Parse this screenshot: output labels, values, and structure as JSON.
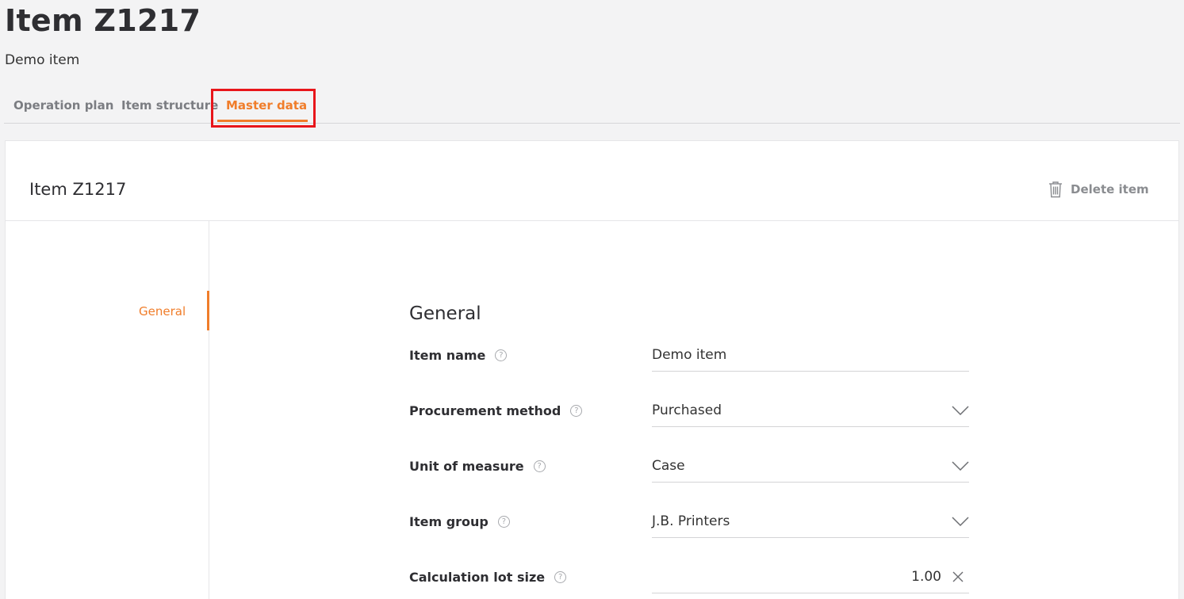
{
  "page": {
    "title": "Item Z1217",
    "subtitle": "Demo item"
  },
  "tabs": [
    {
      "label": "Operation plan"
    },
    {
      "label": "Item structure"
    },
    {
      "label": "Master data"
    }
  ],
  "card": {
    "title": "Item Z1217",
    "delete_label": "Delete item"
  },
  "sidenav": {
    "items": [
      {
        "label": "General"
      }
    ]
  },
  "form": {
    "section_title": "General",
    "fields": [
      {
        "label": "Item name",
        "value": "Demo item"
      },
      {
        "label": "Procurement method",
        "value": "Purchased"
      },
      {
        "label": "Unit of measure",
        "value": "Case"
      },
      {
        "label": "Item group",
        "value": "J.B. Printers"
      },
      {
        "label": "Calculation lot size",
        "value": "1.00"
      }
    ]
  },
  "icons": {
    "help": "question-circle-icon",
    "dropdown": "chevron-down-icon",
    "clear": "close-icon",
    "delete": "trash-icon"
  },
  "colors": {
    "accent": "#f07d2a",
    "highlight": "#e8161b",
    "background": "#f3f3f4"
  }
}
